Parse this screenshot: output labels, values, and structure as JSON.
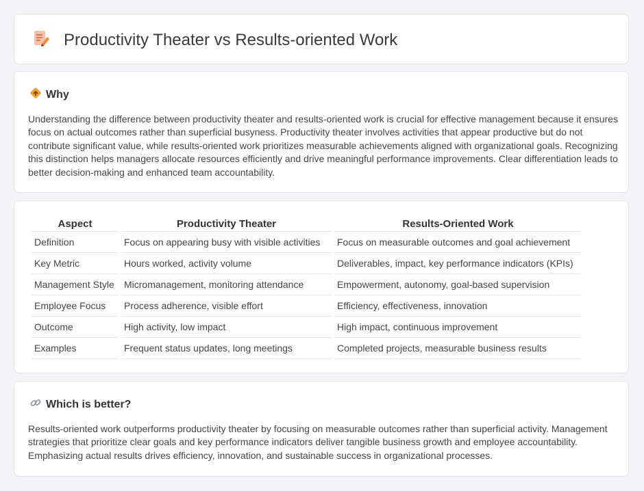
{
  "header": {
    "title": "Productivity Theater vs Results-oriented Work",
    "icon": "document-pencil-icon"
  },
  "why": {
    "title": "Why",
    "icon": "road-sign-icon",
    "text": "Understanding the difference between productivity theater and results-oriented work is crucial for effective management because it ensures focus on actual outcomes rather than superficial busyness. Productivity theater involves activities that appear productive but do not contribute significant value, while results-oriented work prioritizes measurable achievements aligned with organizational goals. Recognizing this distinction helps managers allocate resources efficiently and drive meaningful performance improvements. Clear differentiation leads to better decision-making and enhanced team accountability."
  },
  "comparison": {
    "headers": [
      "Aspect",
      "Productivity Theater",
      "Results-Oriented Work"
    ],
    "rows": [
      [
        "Definition",
        "Focus on appearing busy with visible activities",
        "Focus on measurable outcomes and goal achievement"
      ],
      [
        "Key Metric",
        "Hours worked, activity volume",
        "Deliverables, impact, key performance indicators (KPIs)"
      ],
      [
        "Management Style",
        "Micromanagement, monitoring attendance",
        "Empowerment, autonomy, goal-based supervision"
      ],
      [
        "Employee Focus",
        "Process adherence, visible effort",
        "Efficiency, effectiveness, innovation"
      ],
      [
        "Outcome",
        "High activity, low impact",
        "High impact, continuous improvement"
      ],
      [
        "Examples",
        "Frequent status updates, long meetings",
        "Completed projects, measurable business results"
      ]
    ]
  },
  "better": {
    "title": "Which is better?",
    "icon": "link-icon",
    "text": "Results-oriented work outperforms productivity theater by focusing on measurable outcomes rather than superficial activity. Management strategies that prioritize clear goals and key performance indicators deliver tangible business growth and employee accountability. Emphasizing actual results drives efficiency, innovation, and sustainable success in organizational processes."
  },
  "colors": {
    "accent": "#f0883e",
    "background": "#f4f4f6",
    "card": "#ffffff"
  }
}
